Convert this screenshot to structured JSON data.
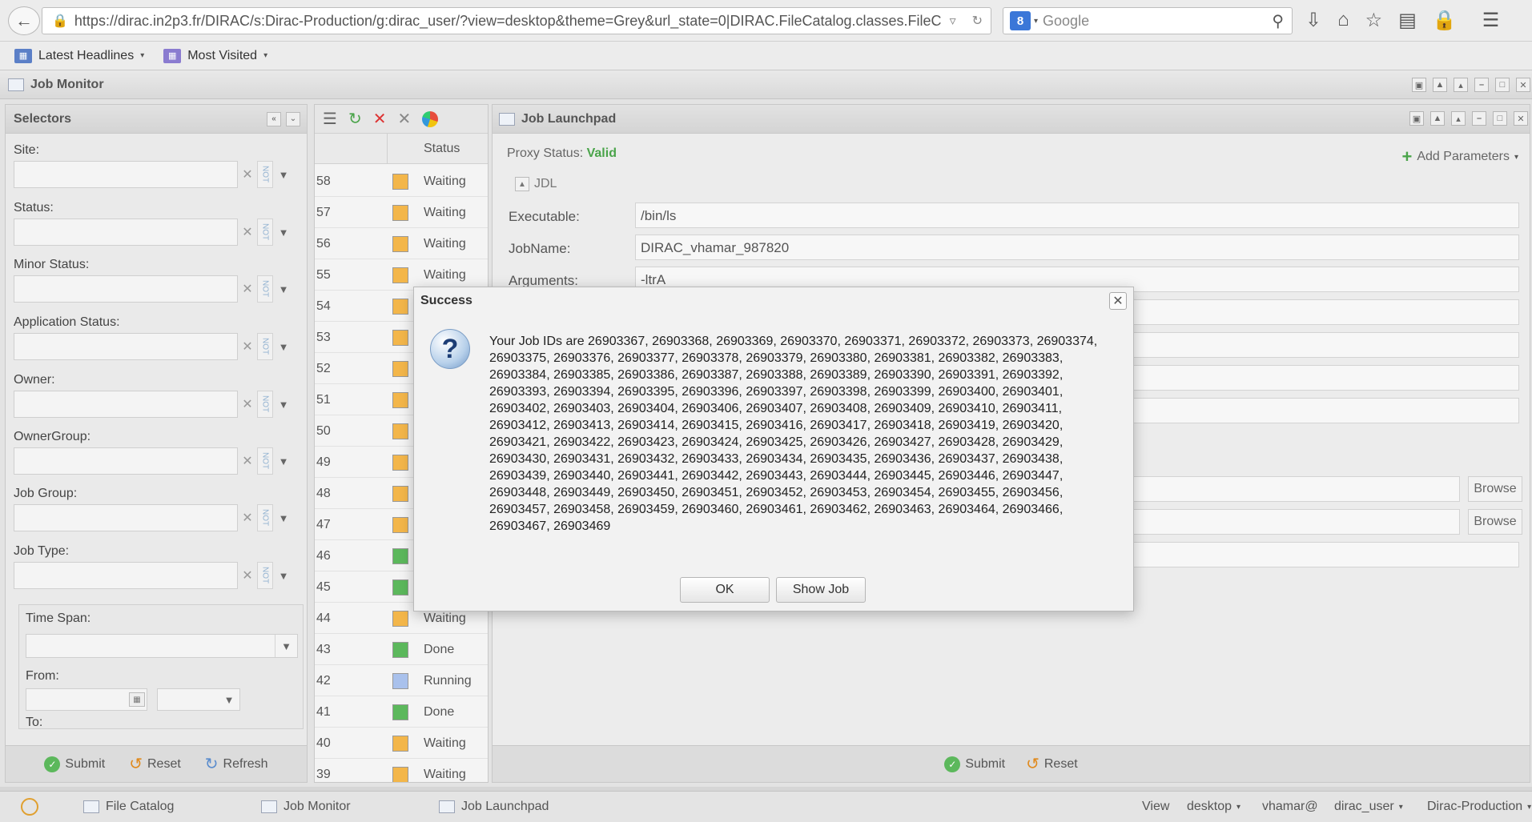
{
  "browser": {
    "url": "https://dirac.in2p3.fr/DIRAC/s:Dirac-Production/g:dirac_user/?view=desktop&theme=Grey&url_state=0|DIRAC.FileCatalog.classes.FileC",
    "search_placeholder": "Google",
    "search_engine_badge": "8"
  },
  "bookmarks": {
    "latest_headlines": "Latest Headlines",
    "most_visited": "Most Visited"
  },
  "window": {
    "title": "Job Monitor"
  },
  "selectors": {
    "title": "Selectors",
    "fields": {
      "site": "Site:",
      "status": "Status:",
      "minor_status": "Minor Status:",
      "application_status": "Application Status:",
      "owner": "Owner:",
      "owner_group": "OwnerGroup:",
      "job_group": "Job Group:",
      "job_type": "Job Type:"
    },
    "not_label": "NOT",
    "time_span": "Time Span:",
    "from": "From:",
    "to": "To:",
    "submit": "Submit",
    "reset": "Reset",
    "refresh": "Refresh"
  },
  "job_table": {
    "status_header": "Status",
    "rows": [
      {
        "id": "58",
        "status": "Waiting",
        "color": "#f3b64a"
      },
      {
        "id": "57",
        "status": "Waiting",
        "color": "#f3b64a"
      },
      {
        "id": "56",
        "status": "Waiting",
        "color": "#f3b64a"
      },
      {
        "id": "55",
        "status": "Waiting",
        "color": "#f3b64a"
      },
      {
        "id": "54",
        "status": "",
        "color": "#f3b64a"
      },
      {
        "id": "53",
        "status": "",
        "color": "#f3b64a"
      },
      {
        "id": "52",
        "status": "",
        "color": "#f3b64a"
      },
      {
        "id": "51",
        "status": "",
        "color": "#f3b64a"
      },
      {
        "id": "50",
        "status": "",
        "color": "#f3b64a"
      },
      {
        "id": "49",
        "status": "",
        "color": "#f3b64a"
      },
      {
        "id": "48",
        "status": "",
        "color": "#f3b64a"
      },
      {
        "id": "47",
        "status": "",
        "color": "#f3b64a"
      },
      {
        "id": "46",
        "status": "",
        "color": "#5cb85c"
      },
      {
        "id": "45",
        "status": "",
        "color": "#5cb85c"
      },
      {
        "id": "44",
        "status": "Waiting",
        "color": "#f3b64a"
      },
      {
        "id": "43",
        "status": "Done",
        "color": "#5cb85c"
      },
      {
        "id": "42",
        "status": "Running",
        "color": "#a9c1ec"
      },
      {
        "id": "41",
        "status": "Done",
        "color": "#5cb85c"
      },
      {
        "id": "40",
        "status": "Waiting",
        "color": "#f3b64a"
      },
      {
        "id": "39",
        "status": "Waiting",
        "color": "#f3b64a"
      }
    ]
  },
  "launchpad": {
    "title": "Job Launchpad",
    "proxy_label": "Proxy Status:",
    "proxy_value": "Valid",
    "add_parameters": "Add Parameters",
    "jdl_legend": "JDL",
    "executable_label": "Executable:",
    "executable_value": "/bin/ls",
    "jobname_label": "JobName:",
    "jobname_value": "DIRAC_vhamar_987820",
    "arguments_label": "Arguments:",
    "arguments_value": "-ltrA",
    "browse": "Browse",
    "submit": "Submit",
    "reset": "Reset"
  },
  "dialog": {
    "title": "Success",
    "message": "Your Job IDs are 26903367, 26903368, 26903369, 26903370, 26903371, 26903372, 26903373, 26903374, 26903375, 26903376, 26903377, 26903378, 26903379, 26903380, 26903381, 26903382, 26903383, 26903384, 26903385, 26903386, 26903387, 26903388, 26903389, 26903390, 26903391, 26903392, 26903393, 26903394, 26903395, 26903396, 26903397, 26903398, 26903399, 26903400, 26903401, 26903402, 26903403, 26903404, 26903406, 26903407, 26903408, 26903409, 26903410, 26903411, 26903412, 26903413, 26903414, 26903415, 26903416, 26903417, 26903418, 26903419, 26903420, 26903421, 26903422, 26903423, 26903424, 26903425, 26903426, 26903427, 26903428, 26903429, 26903430, 26903431, 26903432, 26903433, 26903434, 26903435, 26903436, 26903437, 26903438, 26903439, 26903440, 26903441, 26903442, 26903443, 26903444, 26903445, 26903446, 26903447, 26903448, 26903449, 26903450, 26903451, 26903452, 26903453, 26903454, 26903455, 26903456, 26903457, 26903458, 26903459, 26903460, 26903461, 26903462, 26903463, 26903464, 26903466, 26903467, 26903469",
    "ok": "OK",
    "show_job": "Show Job"
  },
  "taskbar": {
    "file_catalog": "File Catalog",
    "job_monitor": "Job Monitor",
    "job_launchpad": "Job Launchpad",
    "view": "View",
    "desktop": "desktop",
    "user": "vhamar@",
    "group": "dirac_user",
    "setup": "Dirac-Production"
  }
}
